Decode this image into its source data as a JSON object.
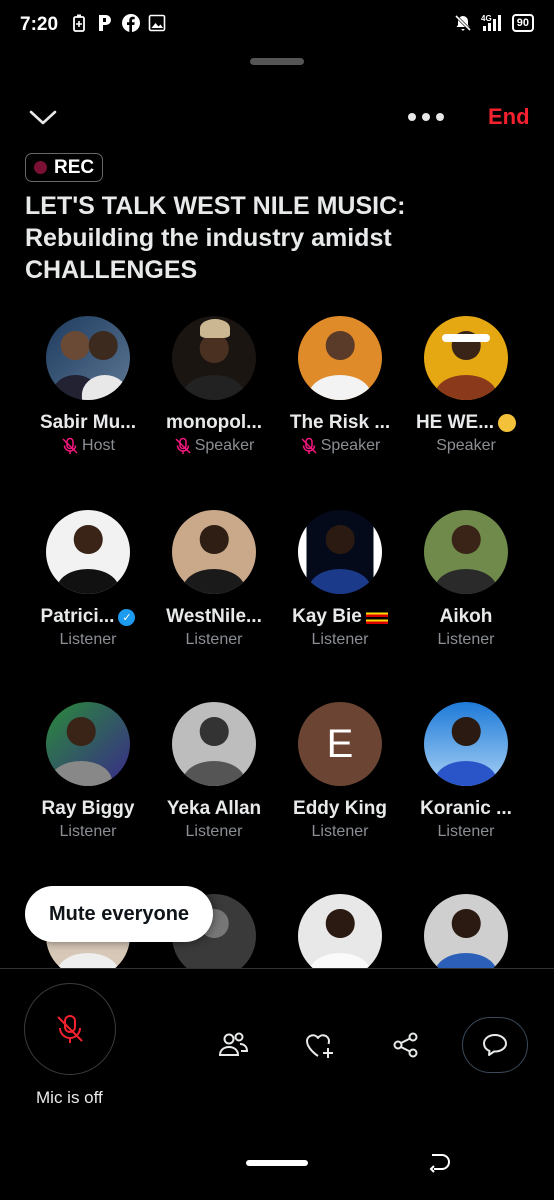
{
  "status_bar": {
    "time": "7:20",
    "left_icons": [
      "battery-saver-icon",
      "parking-app-icon",
      "facebook-icon",
      "image-icon"
    ],
    "right_icons": [
      "notifications-muted-icon",
      "signal-4g-icon"
    ],
    "network": "4G",
    "battery": "90"
  },
  "header": {
    "end_label": "End",
    "rec_label": "REC",
    "title": "LET'S TALK WEST NILE MUSIC: Rebuilding the industry amidst CHALLENGES"
  },
  "participants": [
    {
      "name": "Sabir Mu...",
      "role": "Host",
      "muted": true
    },
    {
      "name": "monopol...",
      "role": "Speaker",
      "muted": true
    },
    {
      "name": "The Risk ...",
      "role": "Speaker",
      "muted": true
    },
    {
      "name": "HE WE...",
      "role": "Speaker",
      "muted": false
    },
    {
      "name": "Patrici...",
      "role": "Listener",
      "verified": true
    },
    {
      "name": "WestNile...",
      "role": "Listener"
    },
    {
      "name": "Kay Bie",
      "role": "Listener",
      "flag": "uganda"
    },
    {
      "name": "Aikoh",
      "role": "Listener"
    },
    {
      "name": "Ray Biggy",
      "role": "Listener"
    },
    {
      "name": "Yeka Allan",
      "role": "Listener"
    },
    {
      "name": "Eddy King",
      "role": "Listener",
      "initial": "E"
    },
    {
      "name": "Koranic ...",
      "role": "Listener"
    }
  ],
  "mute_everyone_label": "Mute everyone",
  "bottom": {
    "mic_label": "Mic is off"
  },
  "colors": {
    "accent_end": "#f4212e",
    "muted_mic": "#f91880",
    "verified": "#1d9bf0"
  }
}
